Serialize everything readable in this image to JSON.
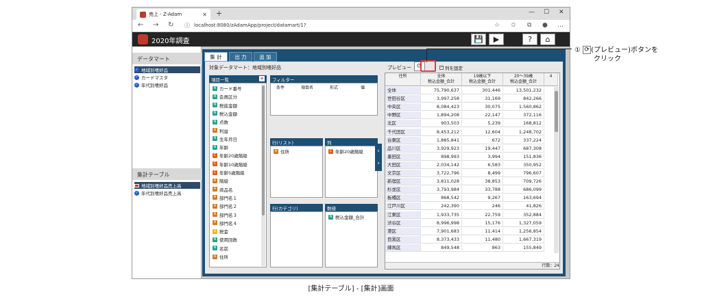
{
  "browser": {
    "tab_title": "売上 - Z-Adam",
    "url": "localhost:8080/zAdamApp/project/datamart/1?",
    "newtab_glyph": "+",
    "minimize": "—",
    "maximize": "☐",
    "close": "✕"
  },
  "app": {
    "title": "2020年調査"
  },
  "left": {
    "datamart_head": "データマート",
    "datamart_items": [
      "地域別嗜好品",
      "カードマスタ",
      "年代別嗜好品"
    ],
    "table_head": "集計テーブル",
    "table_items": [
      "地域別嗜好品売上高",
      "年代別嗜好品売上高"
    ]
  },
  "tabs": [
    "集 計",
    "出 力",
    "追 加"
  ],
  "target": "対象データマート：地域別嗜好品",
  "items_head": "項目一覧",
  "fields": [
    {
      "icon": "n",
      "label": "カード番号"
    },
    {
      "icon": "n",
      "label": "会員区分"
    },
    {
      "icon": "n",
      "label": "税抜金額"
    },
    {
      "icon": "n",
      "label": "税込金額"
    },
    {
      "icon": "n",
      "label": "点数"
    },
    {
      "icon": "a",
      "label": "利益"
    },
    {
      "icon": "n",
      "label": "生年月日"
    },
    {
      "icon": "n",
      "label": "年齢"
    },
    {
      "icon": "c",
      "label": "年齢20歳階級"
    },
    {
      "icon": "c",
      "label": "年齢10歳階級"
    },
    {
      "icon": "c",
      "label": "年齢5歳階級"
    },
    {
      "icon": "a",
      "label": "階級"
    },
    {
      "icon": "a",
      "label": "商品名"
    },
    {
      "icon": "a",
      "label": "部門名１"
    },
    {
      "icon": "a",
      "label": "部門名２"
    },
    {
      "icon": "a",
      "label": "部門名３"
    },
    {
      "icon": "a",
      "label": "部門名４"
    },
    {
      "icon": "y",
      "label": "税金"
    },
    {
      "icon": "n",
      "label": "使用回数"
    },
    {
      "icon": "n",
      "label": "名前"
    },
    {
      "icon": "a",
      "label": "住所"
    }
  ],
  "filter": {
    "head": "フィルター",
    "cols": [
      "条件",
      "項目名",
      "形式",
      "値"
    ]
  },
  "rows_head": "行(リスト)",
  "rows_item": "住所",
  "cols_head": "列",
  "cols_item": "年齢20歳階級",
  "cat_head": "行(カテゴリ)",
  "val_head": "数値",
  "val_item": "税込金額_合計",
  "preview": {
    "label": "プレビュー",
    "fix_label": "列を固定",
    "headers": [
      "住所",
      "全体\n税込金額_合計",
      "19歳以下\n税込金額_合計",
      "20～39歳\n税込金額_合計",
      "4"
    ],
    "rows": [
      [
        "全体",
        "75,790,637",
        "301,446",
        "13,501,232"
      ],
      [
        "世田谷区",
        "3,997,258",
        "31,169",
        "842,266"
      ],
      [
        "中央区",
        "8,084,423",
        "30,075",
        "1,560,862"
      ],
      [
        "中野区",
        "1,894,208",
        "22,147",
        "372,116"
      ],
      [
        "北区",
        "903,503",
        "5,239",
        "168,812"
      ],
      [
        "千代田区",
        "8,453,212",
        "12,604",
        "1,248,702"
      ],
      [
        "台東区",
        "1,885,841",
        "672",
        "337,224"
      ],
      [
        "品川区",
        "3,929,923",
        "19,447",
        "687,308"
      ],
      [
        "墨田区",
        "898,993",
        "3,994",
        "151,836"
      ],
      [
        "大田区",
        "2,034,142",
        "6,583",
        "350,952"
      ],
      [
        "文京区",
        "3,722,796",
        "8,499",
        "796,607"
      ],
      [
        "新宿区",
        "3,811,028",
        "38,853",
        "709,726"
      ],
      [
        "杉並区",
        "3,793,984",
        "33,788",
        "686,099"
      ],
      [
        "板橋区",
        "868,542",
        "9,267",
        "163,694"
      ],
      [
        "江戸川区",
        "242,390",
        "246",
        "41,826"
      ],
      [
        "江東区",
        "1,933,735",
        "22,759",
        "352,884"
      ],
      [
        "渋谷区",
        "8,996,998",
        "15,176",
        "1,327,059"
      ],
      [
        "港区",
        "7,901,683",
        "11,414",
        "1,256,854"
      ],
      [
        "目黒区",
        "8,373,433",
        "11,480",
        "1,667,319"
      ],
      [
        "練馬区",
        "849,548",
        "863",
        "155,849"
      ]
    ],
    "footer": "行数：24"
  },
  "callout": {
    "num": "①",
    "text1": "(プレビュー)ボタンを",
    "text2": "クリック"
  },
  "caption": "[集計テーブル] - [集計]画面"
}
